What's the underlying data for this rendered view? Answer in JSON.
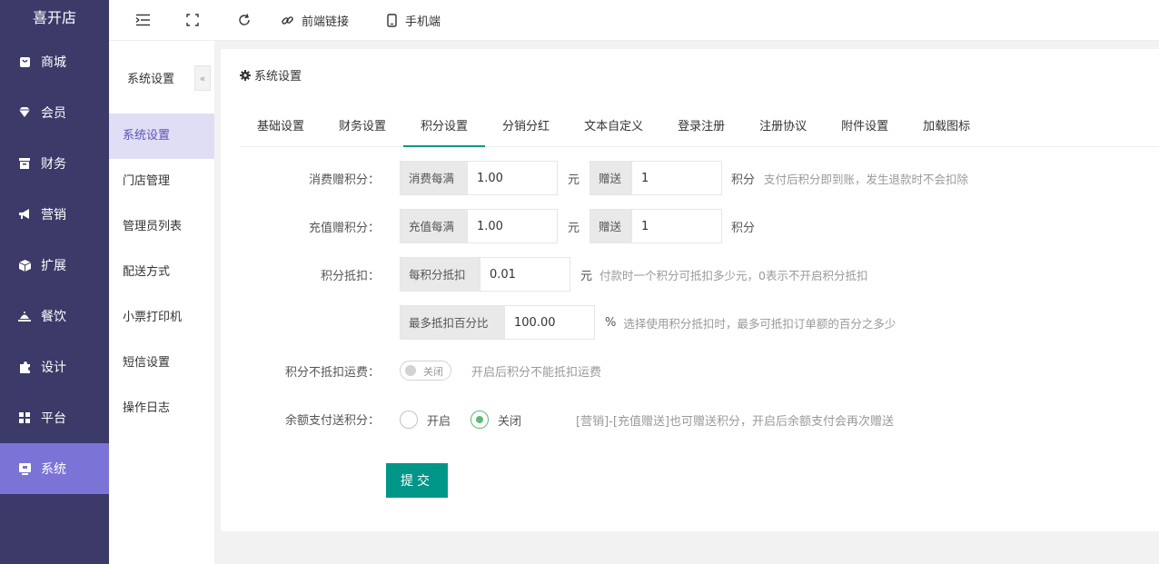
{
  "app": {
    "logo": "喜开店"
  },
  "nav": {
    "items": [
      {
        "label": "商城",
        "icon": "shop-bag-icon",
        "active": false
      },
      {
        "label": "会员",
        "icon": "member-tag-icon",
        "active": false
      },
      {
        "label": "财务",
        "icon": "finance-box-icon",
        "active": false
      },
      {
        "label": "营销",
        "icon": "megaphone-icon",
        "active": false
      },
      {
        "label": "扩展",
        "icon": "cube-icon",
        "active": false
      },
      {
        "label": "餐饮",
        "icon": "dish-cover-icon",
        "active": false
      },
      {
        "label": "设计",
        "icon": "puzzle-icon",
        "active": false
      },
      {
        "label": "平台",
        "icon": "grid-icon",
        "active": false
      },
      {
        "label": "系统",
        "icon": "system-monitor-icon",
        "active": true
      }
    ]
  },
  "topbar": {
    "frontend_link": "前端链接",
    "mobile": "手机端"
  },
  "subnav": {
    "title": "系统设置",
    "collapse": "«",
    "items": [
      {
        "label": "系统设置",
        "active": true
      },
      {
        "label": "门店管理",
        "active": false
      },
      {
        "label": "管理员列表",
        "active": false
      },
      {
        "label": "配送方式",
        "active": false
      },
      {
        "label": "小票打印机",
        "active": false
      },
      {
        "label": "短信设置",
        "active": false
      },
      {
        "label": "操作日志",
        "active": false
      }
    ]
  },
  "panel": {
    "title": "系统设置",
    "tabs": [
      {
        "label": "基础设置",
        "active": false
      },
      {
        "label": "财务设置",
        "active": false
      },
      {
        "label": "积分设置",
        "active": true
      },
      {
        "label": "分销分红",
        "active": false
      },
      {
        "label": "文本自定义",
        "active": false
      },
      {
        "label": "登录注册",
        "active": false
      },
      {
        "label": "注册协议",
        "active": false
      },
      {
        "label": "附件设置",
        "active": false
      },
      {
        "label": "加载图标",
        "active": false
      }
    ]
  },
  "form": {
    "consume": {
      "label": "消费赠积分：",
      "prefix": "消费每满",
      "amount": "1.00",
      "unit": "元",
      "give_label": "赠送",
      "give_value": "1",
      "give_unit": "积分",
      "tip": "支付后积分即到账，发生退款时不会扣除"
    },
    "recharge": {
      "label": "充值赠积分：",
      "prefix": "充值每满",
      "amount": "1.00",
      "unit": "元",
      "give_label": "赠送",
      "give_value": "1",
      "give_unit": "积分"
    },
    "deduct": {
      "label": "积分抵扣：",
      "prefix": "每积分抵扣",
      "value": "0.01",
      "unit": "元",
      "tip": "付款时一个积分可抵扣多少元，0表示不开启积分抵扣"
    },
    "max_percent": {
      "prefix": "最多抵扣百分比",
      "value": "100.00",
      "unit": "%",
      "tip": "选择使用积分抵扣时，最多可抵扣订单额的百分之多少"
    },
    "freight": {
      "label": "积分不抵扣运费：",
      "switch_text": "关闭",
      "switch_on": false,
      "tip": "开启后积分不能抵扣运费"
    },
    "balance": {
      "label": "余额支付送积分：",
      "options": [
        "开启",
        "关闭"
      ],
      "selected": "关闭",
      "tip": "[营销]-[充值赠送]也可赠送积分，开启后余额支付会再次赠送"
    },
    "submit": "提交"
  },
  "colors": {
    "nav_bg": "#3b3a69",
    "nav_active": "#7b73d6",
    "accent": "#009688",
    "radio_checked": "#5fb878"
  }
}
